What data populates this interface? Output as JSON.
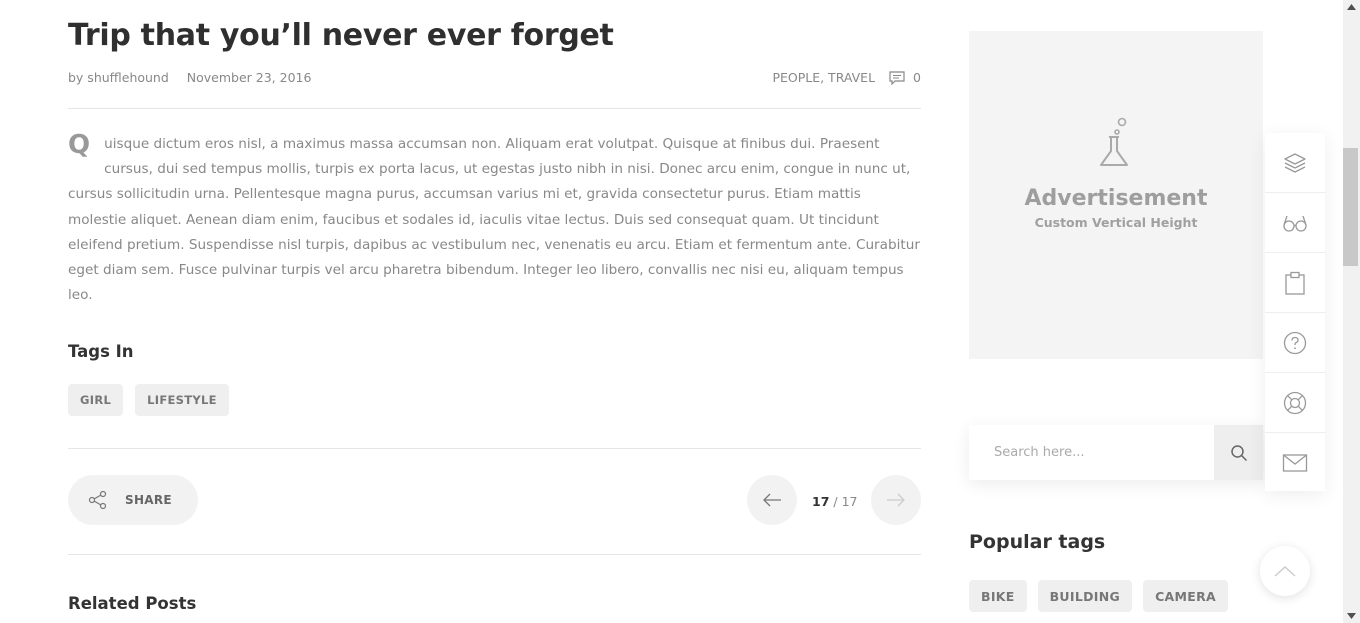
{
  "post": {
    "title": "Trip that you’ll never ever forget",
    "author": "by shufflehound",
    "date": "November 23, 2016",
    "categories": "PEOPLE, TRAVEL",
    "comments": "0",
    "dropcap": "Q",
    "body": "uisque dictum eros nisl, a maximus massa accumsan non. Aliquam erat volutpat. Quisque at finibus dui. Praesent cursus, dui sed tempus mollis, turpis ex porta lacus, ut egestas justo nibh in nisi. Donec arcu enim, congue in nunc ut, cursus sollicitudin urna. Pellentesque magna purus, accumsan varius mi et, gravida consectetur purus. Etiam mattis molestie aliquet. Aenean diam enim, faucibus et sodales id, iaculis vitae lectus. Duis sed consequat quam. Ut tincidunt eleifend pretium. Suspendisse nisl turpis, dapibus ac vestibulum nec, venenatis eu arcu. Etiam et fermentum ante. Curabitur eget diam sem. Fusce pulvinar turpis vel arcu pharetra bibendum. Integer leo libero, convallis nec nisi eu, aliquam tempus leo."
  },
  "tags": {
    "heading": "Tags In",
    "items": [
      "GIRL",
      "LIFESTYLE"
    ]
  },
  "share": {
    "label": "SHARE"
  },
  "pager": {
    "current": "17",
    "separator": " / ",
    "total": "17"
  },
  "related": {
    "heading": "Related Posts"
  },
  "sidebar": {
    "ad": {
      "title": "Advertisement",
      "subtitle": "Custom Vertical Height"
    },
    "search": {
      "placeholder": "Search here..."
    },
    "popular_tags": {
      "heading": "Popular tags",
      "items": [
        "BIKE",
        "BUILDING",
        "CAMERA"
      ]
    }
  },
  "dock": {
    "icons": [
      "layers-icon",
      "glasses-icon",
      "clipboard-icon",
      "help-icon",
      "lifebuoy-icon",
      "mail-icon"
    ]
  },
  "colors": {
    "text": "#333333",
    "muted": "#888888",
    "tag_bg": "#efefef",
    "ad_bg": "#f4f4f4"
  }
}
